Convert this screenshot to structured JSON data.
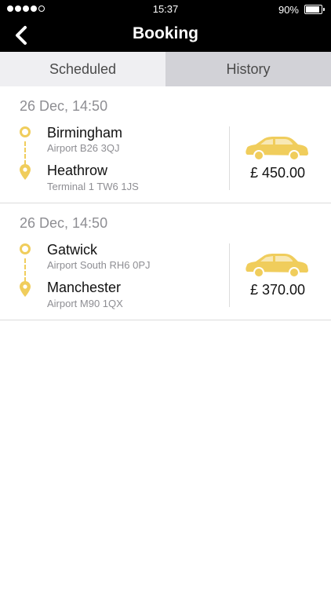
{
  "status_bar": {
    "time": "15:37",
    "battery_text": "90%",
    "battery_level": 0.9,
    "signal_filled": 4,
    "signal_total": 5
  },
  "nav": {
    "title": "Booking",
    "back_icon": "chevron-left-icon"
  },
  "tabs": [
    {
      "label": "Scheduled",
      "selected": true
    },
    {
      "label": "History",
      "selected": false
    }
  ],
  "bookings": [
    {
      "date": "26 Dec, 14:50",
      "from": {
        "name": "Birmingham",
        "address": "Airport B26 3QJ"
      },
      "to": {
        "name": "Heathrow",
        "address": "Terminal 1 TW6 1JS"
      },
      "price": "£ 450.00",
      "vehicle_icon": "car-icon"
    },
    {
      "date": "26 Dec, 14:50",
      "from": {
        "name": "Gatwick",
        "address": "Airport South RH6 0PJ"
      },
      "to": {
        "name": "Manchester",
        "address": "Airport M90 1QX"
      },
      "price": "£ 370.00",
      "vehicle_icon": "car-icon"
    }
  ],
  "colors": {
    "accent": "#f0cd5c",
    "header_bg": "#000000",
    "tab_bg": "#efeff2",
    "tab_bg_alt": "#d2d2d7",
    "muted_text": "#8e8e93"
  }
}
